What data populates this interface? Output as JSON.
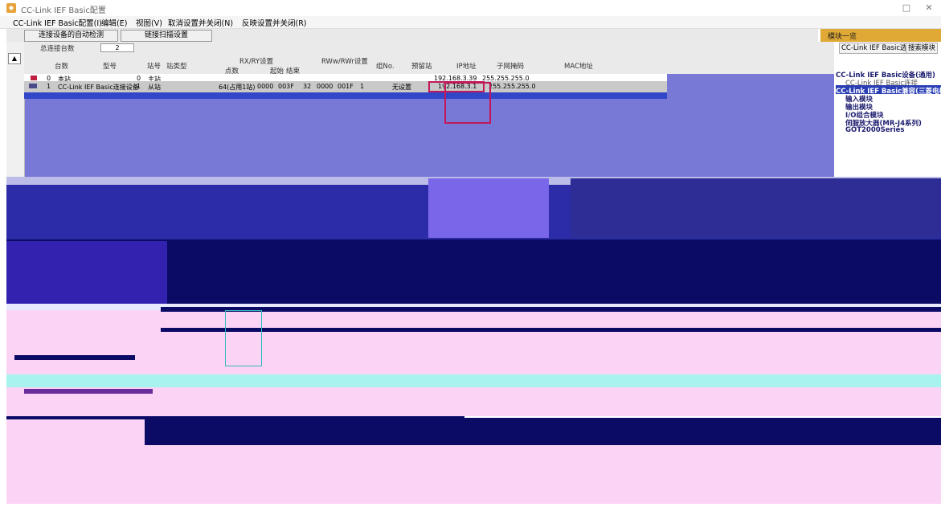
{
  "window": {
    "title": "CC-Link IEF Basic配置",
    "minimize_icon": "□",
    "close_icon": "✕"
  },
  "menu": [
    "CC-Link IEF Basic配置(I)",
    "编辑(E)",
    "视图(V)",
    "取消设置并关闭(N)",
    "反映设置并关闭(R)"
  ],
  "toolbar": {
    "auto_detect_button": "连接设备的自动检测",
    "link_scan_button": "链接扫描设置"
  },
  "grid": {
    "total_devices_label": "总连接台数",
    "total_devices_value": "2",
    "headers": {
      "count": "台数",
      "model": "型号",
      "station_no": "站号",
      "station_type": "站类型",
      "rxry": "RX/RY设置",
      "rwwrwr": "RWw/RWr设置",
      "group": "组No.",
      "reserved": "预留站",
      "ip": "IP地址",
      "subnet": "子网掩码",
      "mac": "MAC地址",
      "points": "点数",
      "start": "起始",
      "end": "结束"
    },
    "rows": [
      {
        "no": "0",
        "name": "本站",
        "station_no": "0",
        "type": "主站",
        "ip": "192.168.3.39",
        "subnet": "255.255.255.0"
      },
      {
        "no": "1",
        "name": "CC-Link IEF Basic连接设备",
        "station_no": "1",
        "type": "从站",
        "points": "64(占用1站)",
        "rx_start": "0000",
        "rx_end": "003F",
        "rw_points": "32",
        "rw_start": "0000",
        "rw_end": "001F",
        "group": "1",
        "reserved": "无设置",
        "ip": "192.168.3.1",
        "subnet": "255.255.255.0"
      }
    ]
  },
  "right_panel": {
    "header": "模块一览",
    "tab_select": "CC-Link IEF Basic选择",
    "tab_search": "搜索模块",
    "tree": [
      "CC-Link IEF Basic设备(通用)",
      "CC-Link IEF Basic连接",
      "CC-Link IEF Basic兼容(三菱电机)",
      "输入模块",
      "输出模块",
      "I/O组合模块",
      "伺服放大器(MR-J4系列)",
      "GOT2000Series"
    ]
  },
  "colors": {
    "accent_red": "#c2185b",
    "grid_blue": "#7878d6",
    "dark_navy": "#0b0b66",
    "pink": "#fbd4f5",
    "cyan": "#a8f3f0"
  }
}
